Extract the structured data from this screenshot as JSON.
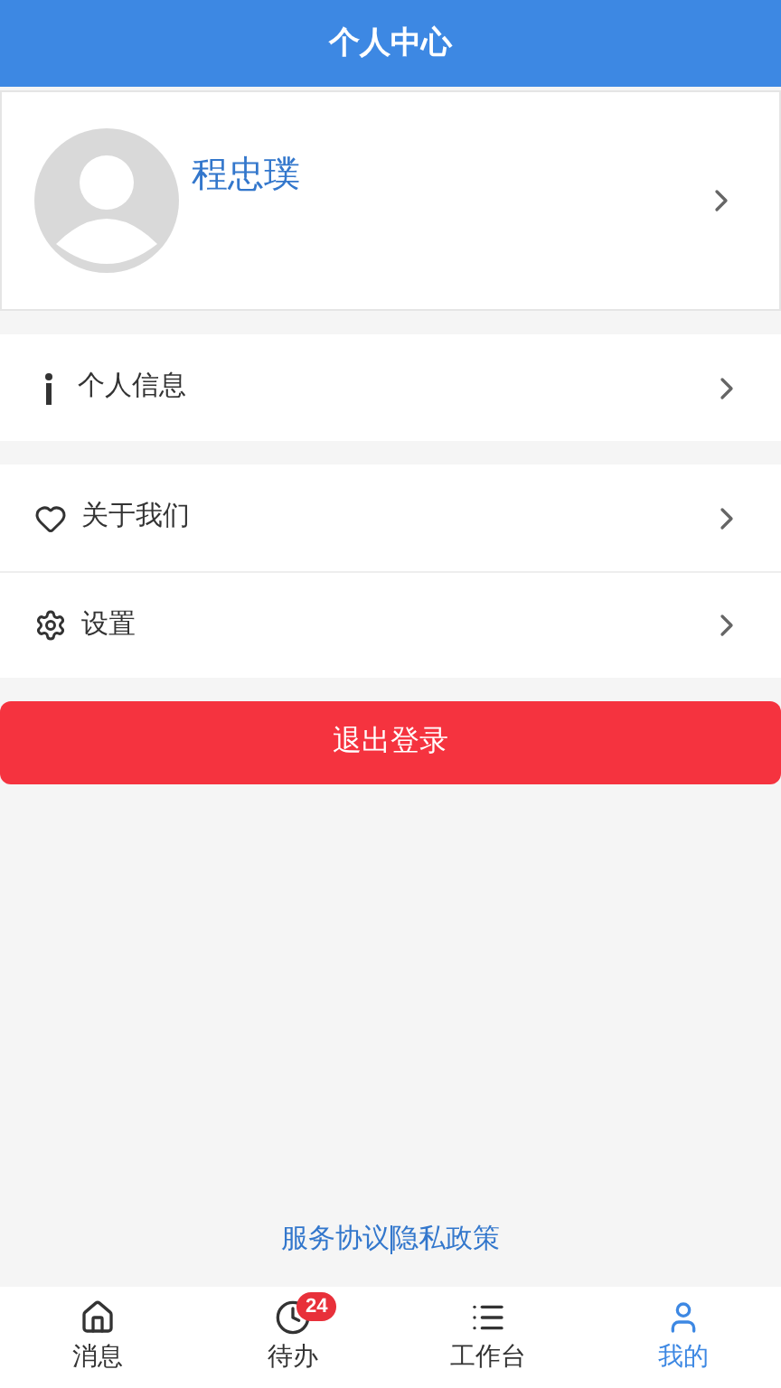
{
  "header": {
    "title": "个人中心"
  },
  "profile": {
    "name": "程忠璞"
  },
  "menu_groups": [
    [
      {
        "kind": "info",
        "label": "个人信息"
      }
    ],
    [
      {
        "kind": "heart",
        "label": "关于我们"
      },
      {
        "kind": "gear",
        "label": "设置"
      }
    ]
  ],
  "logout_button": "退出登录",
  "footer_links": [
    "服务协议",
    "隐私政策"
  ],
  "tab_bar": [
    {
      "kind": "home",
      "label": "消息",
      "selected": false
    },
    {
      "kind": "clock",
      "label": "待办",
      "selected": false,
      "badge": "24"
    },
    {
      "kind": "list",
      "label": "工作台",
      "selected": false
    },
    {
      "kind": "person",
      "label": "我的",
      "selected": true
    }
  ]
}
